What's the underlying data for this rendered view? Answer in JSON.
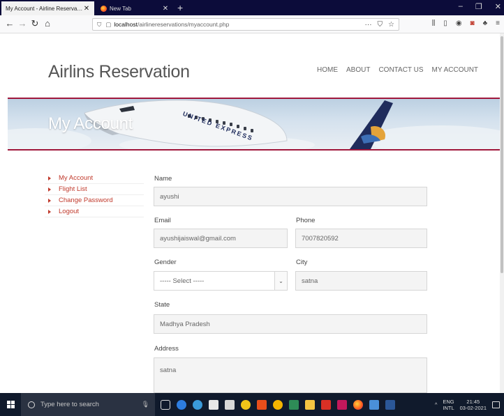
{
  "browser": {
    "tabs": [
      {
        "title": "My Account - Airline Reservation S",
        "active": true
      },
      {
        "title": "New Tab",
        "active": false
      }
    ],
    "url_host": "localhost",
    "url_path": "/airlinereservations/myaccount.php",
    "url_more": "···"
  },
  "site": {
    "title": "Airlins Reservation",
    "nav": [
      "HOME",
      "ABOUT",
      "CONTACT US",
      "MY ACCOUNT"
    ]
  },
  "banner": {
    "title": "My Account",
    "plane_text": "UNITED EXPRESS"
  },
  "sidebar": {
    "items": [
      {
        "label": "My Account"
      },
      {
        "label": "Flight List"
      },
      {
        "label": "Change Password"
      },
      {
        "label": "Logout"
      }
    ]
  },
  "form": {
    "name": {
      "label": "Name",
      "value": "ayushi"
    },
    "email": {
      "label": "Email",
      "value": "ayushijaiswal@gmail.com"
    },
    "phone": {
      "label": "Phone",
      "value": "7007820592"
    },
    "gender": {
      "label": "Gender",
      "value": "----- Select -----"
    },
    "city": {
      "label": "City",
      "value": "satna"
    },
    "state": {
      "label": "State",
      "value": "Madhya Pradesh"
    },
    "address": {
      "label": "Address",
      "value": "satna"
    }
  },
  "taskbar": {
    "search_placeholder": "Type here to search",
    "lang": "ENG",
    "layout": "INTL",
    "time": "21:45",
    "date": "03-02-2021"
  },
  "colors": {
    "accent": "#a0173b",
    "link": "#c0392b",
    "taskbar": "#101a2c"
  }
}
